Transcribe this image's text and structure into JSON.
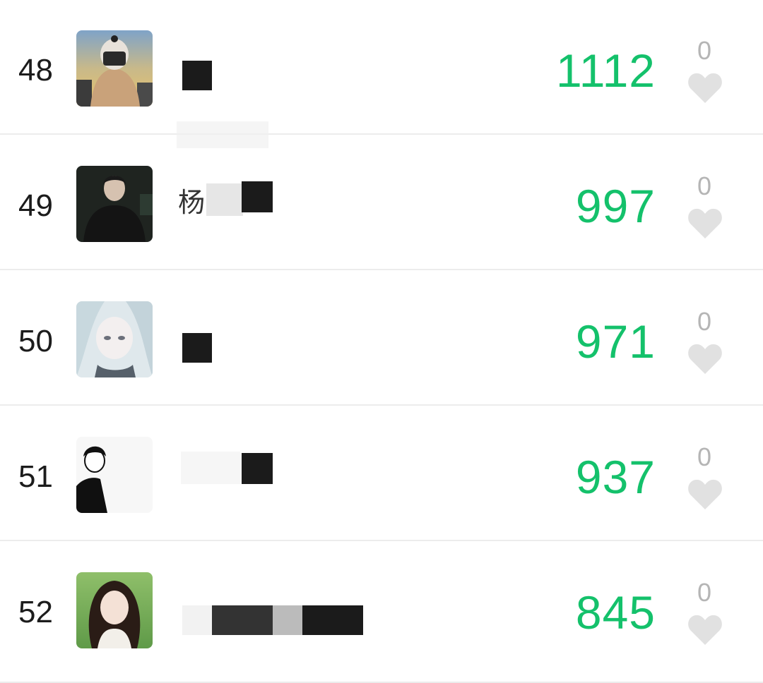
{
  "leaderboard": {
    "rows": [
      {
        "rank": "48",
        "name": "",
        "score": "1112",
        "likes": "0",
        "avatar": "avatar-hooded-person-sunset"
      },
      {
        "rank": "49",
        "name": "杨",
        "score": "997",
        "likes": "0",
        "avatar": "avatar-man-dark-jacket"
      },
      {
        "rank": "50",
        "name": "",
        "score": "971",
        "likes": "0",
        "avatar": "avatar-anime-girl-white-hair"
      },
      {
        "rank": "51",
        "name": "",
        "score": "937",
        "likes": "0",
        "avatar": "avatar-sketch-boy-black-white"
      },
      {
        "rank": "52",
        "name": "",
        "score": "845",
        "likes": "0",
        "avatar": "avatar-woman-portrait-green"
      }
    ]
  },
  "colors": {
    "score": "#14c16b",
    "like_icon": "#e1e1e1",
    "like_count": "#b5b5b5",
    "rank": "#1c1c1c",
    "divider": "#ececec"
  },
  "icons": {
    "like": "heart-icon"
  }
}
